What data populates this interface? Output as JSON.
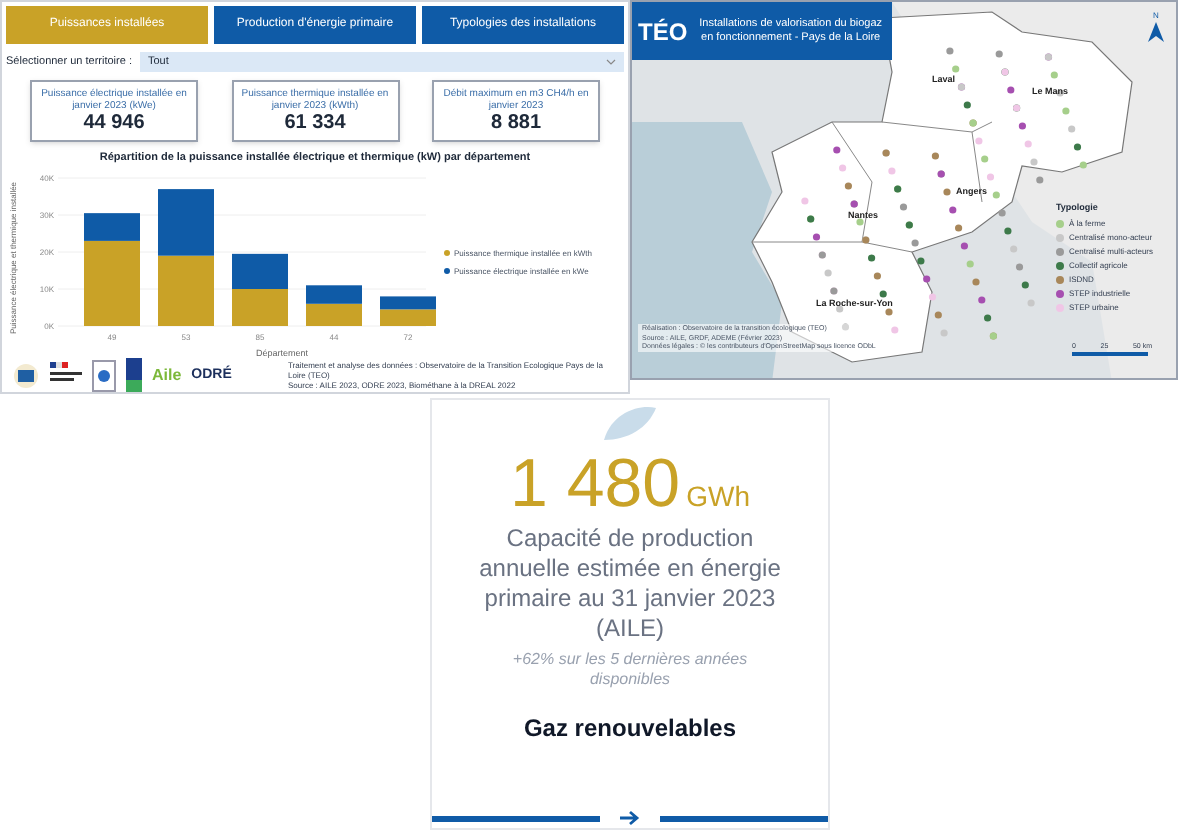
{
  "tabs": [
    {
      "label": "Puissances installées",
      "selected": true
    },
    {
      "label": "Production d'énergie primaire",
      "selected": false
    },
    {
      "label": "Typologies des installations",
      "selected": false
    }
  ],
  "territory": {
    "label": "Sélectionner un territoire :",
    "value": "Tout"
  },
  "kpis": [
    {
      "label": "Puissance électrique installée en janvier 2023 (kWe)",
      "value": "44 946"
    },
    {
      "label": "Puissance thermique installée en janvier 2023 (kWth)",
      "value": "61 334"
    },
    {
      "label": "Débit maximum en m3 CH4/h en janvier 2023",
      "value": "8 881"
    }
  ],
  "chart": {
    "chart_data": {
      "type": "bar",
      "title": "Répartition de la puissance installée électrique et thermique (kW) par département",
      "xlabel": "Département",
      "ylabel": "Puissance électrique et thermique installée",
      "categories": [
        "49",
        "53",
        "85",
        "44",
        "72"
      ],
      "grid": true,
      "stacked": true,
      "orientation": "vertical",
      "ylim": [
        0,
        40000
      ],
      "yticks": [
        {
          "value": 0,
          "label": "0K"
        },
        {
          "value": 10000,
          "label": "10K"
        },
        {
          "value": 20000,
          "label": "20K"
        },
        {
          "value": 30000,
          "label": "30K"
        },
        {
          "value": 40000,
          "label": "40K"
        }
      ],
      "series": [
        {
          "name": "Puissance thermique installée en kWth",
          "color": "#c9a227",
          "values": [
            23000,
            19000,
            10000,
            6000,
            4500
          ]
        },
        {
          "name": "Puissance électrique installée en kWe",
          "color": "#0f5ba7",
          "values": [
            7500,
            18000,
            9500,
            5000,
            3500
          ]
        }
      ]
    }
  },
  "logos": [
    "Aile",
    "ODRÉ"
  ],
  "source": [
    "Traitement et analyse des données : Observatoire de la Transition Ecologique Pays de la Loire (TEO)",
    "Source : AILE 2023, ODRE 2023, Biométhane à la DREAL 2022"
  ],
  "map": {
    "logo": "TÉO",
    "title": "Installations de valorisation du biogaz en fonctionnement - Pays de la Loire",
    "north": "N",
    "cities": [
      {
        "name": "Laval"
      },
      {
        "name": "Le Mans"
      },
      {
        "name": "Angers"
      },
      {
        "name": "Nantes"
      },
      {
        "name": "La Roche-sur-Yon"
      }
    ],
    "legend": {
      "title": "Typologie",
      "items": [
        {
          "label": "À la ferme",
          "color": "#a6cf8b"
        },
        {
          "label": "Centralisé mono-acteur",
          "color": "#c8c8c8"
        },
        {
          "label": "Centralisé multi-acteurs",
          "color": "#9a9a9a"
        },
        {
          "label": "Collectif agricole",
          "color": "#3d7a4a"
        },
        {
          "label": "ISDND",
          "color": "#a8875a"
        },
        {
          "label": "STEP industrielle",
          "color": "#a64fb0"
        },
        {
          "label": "STEP urbaine",
          "color": "#f0c6e6"
        }
      ]
    },
    "scale": [
      "0",
      "25",
      "50 km"
    ],
    "credits": [
      "Réalisation : Observatoire de la transition écologique (TEO)",
      "Source : AILE, GRDF, ADEME (Février 2023)",
      "Données légales : © les contributeurs d'OpenStreetMap sous licence ODbL"
    ]
  },
  "card": {
    "value": "1 480",
    "unit": "GWh",
    "description": "Capacité de production annuelle estimée en énergie primaire au 31 janvier 2023 (AILE)",
    "note": "+62% sur les 5 dernières années disponibles",
    "title": "Gaz renouvelables"
  }
}
